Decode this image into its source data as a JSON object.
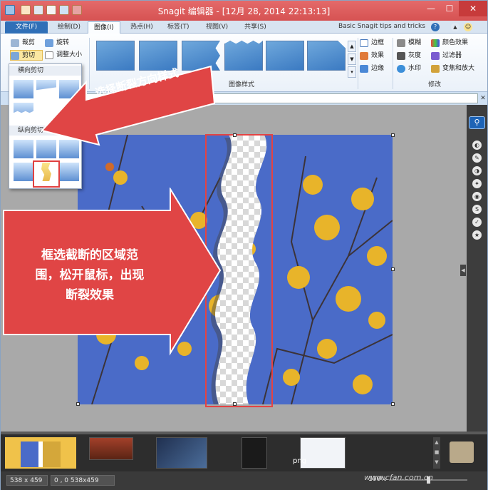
{
  "window": {
    "title": "Snagit 编辑器 - [12月 28, 2014 22:13:13]",
    "minimize": "—",
    "maximize": "☐",
    "close": "✕"
  },
  "tabs": [
    {
      "label": "文件(F)"
    },
    {
      "label": "绘制(D)"
    },
    {
      "label": "图像(I)"
    },
    {
      "label": "热点(H)"
    },
    {
      "label": "标签(T)"
    },
    {
      "label": "视图(V)"
    },
    {
      "label": "共享(S)"
    }
  ],
  "tips": {
    "label": "Basic Snagit tips and tricks",
    "help": "?"
  },
  "ribbon": {
    "crop": "裁剪",
    "rotate": "旋转",
    "cut": "剪切",
    "resize": "调整大小",
    "styles_label": "图像样式",
    "border": "边框",
    "effects": "效果",
    "edges": "边缘",
    "blur": "模糊",
    "grayscale": "灰度",
    "watermark": "水印",
    "color_effects": "颜色效果",
    "filters": "过滤器",
    "spotlight": "变焦和放大",
    "modify_label": "修改"
  },
  "dropdown": {
    "horizontal": "横向剪切",
    "vertical": "纵向剪切"
  },
  "callouts": {
    "top": "选择断裂方向样式",
    "left_line1": "框选截断的区域范",
    "left_line2": "围，松开鼠标，出现",
    "left_line3": "断裂效果"
  },
  "filmstrip": {
    "png_label": "png"
  },
  "status": {
    "size": "538 x 459",
    "coords": "0 , 0  538x459",
    "zoom": "100%"
  },
  "watermark": "www.cfan.com.cn",
  "colors": {
    "titlebar": "#d65252",
    "accent": "#2f6fb7",
    "callout": "#e04545"
  }
}
